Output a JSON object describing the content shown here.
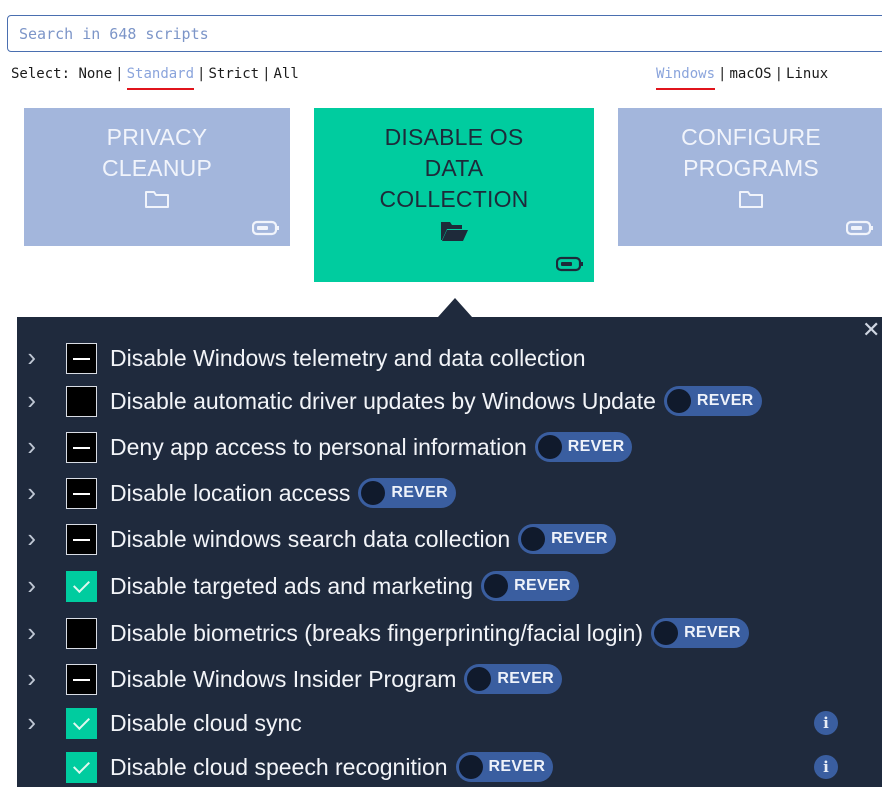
{
  "search": {
    "placeholder": "Search in 648 scripts",
    "value": ""
  },
  "select": {
    "label": "Select:",
    "options": [
      "None",
      "Standard",
      "Strict",
      "All"
    ],
    "active": "Standard"
  },
  "os": {
    "options": [
      "Windows",
      "macOS",
      "Linux"
    ],
    "active": "Windows"
  },
  "cards": [
    {
      "title": "PRIVACY CLEANUP",
      "active": false,
      "folder_icon": "folder-icon"
    },
    {
      "title": "DISABLE OS DATA COLLECTION",
      "active": true,
      "folder_icon": "folder-open-icon"
    },
    {
      "title": "CONFIGURE PROGRAMS",
      "active": false,
      "folder_icon": "folder-icon"
    }
  ],
  "scripts": [
    {
      "label": "Disable Windows telemetry and data collection",
      "state": "indeterminate",
      "expandable": true,
      "revert": false,
      "info": false
    },
    {
      "label": "Disable automatic driver updates by Windows Update",
      "state": "unchecked",
      "expandable": true,
      "revert": true,
      "info": false
    },
    {
      "label": "Deny app access to personal information",
      "state": "indeterminate",
      "expandable": true,
      "revert": true,
      "info": false
    },
    {
      "label": "Disable location access",
      "state": "indeterminate",
      "expandable": true,
      "revert": true,
      "info": false
    },
    {
      "label": "Disable windows search data collection",
      "state": "indeterminate",
      "expandable": true,
      "revert": true,
      "info": false
    },
    {
      "label": "Disable targeted ads and marketing",
      "state": "checked",
      "expandable": true,
      "revert": true,
      "info": false
    },
    {
      "label": "Disable biometrics (breaks fingerprinting/facial login)",
      "state": "unchecked",
      "expandable": true,
      "revert": true,
      "info": false
    },
    {
      "label": "Disable Windows Insider Program",
      "state": "indeterminate",
      "expandable": true,
      "revert": true,
      "info": false
    },
    {
      "label": "Disable cloud sync",
      "state": "checked",
      "expandable": true,
      "revert": false,
      "info": true
    },
    {
      "label": "Disable cloud speech recognition",
      "state": "checked",
      "expandable": false,
      "revert": true,
      "info": true
    }
  ],
  "revert_label": "REVER",
  "colors": {
    "accent": "#00cc9f",
    "card_inactive": "#a3b6dc",
    "panel_bg": "#1f2a3d",
    "toggle_bg": "#3a5ea0",
    "underline": "#e0141c"
  }
}
